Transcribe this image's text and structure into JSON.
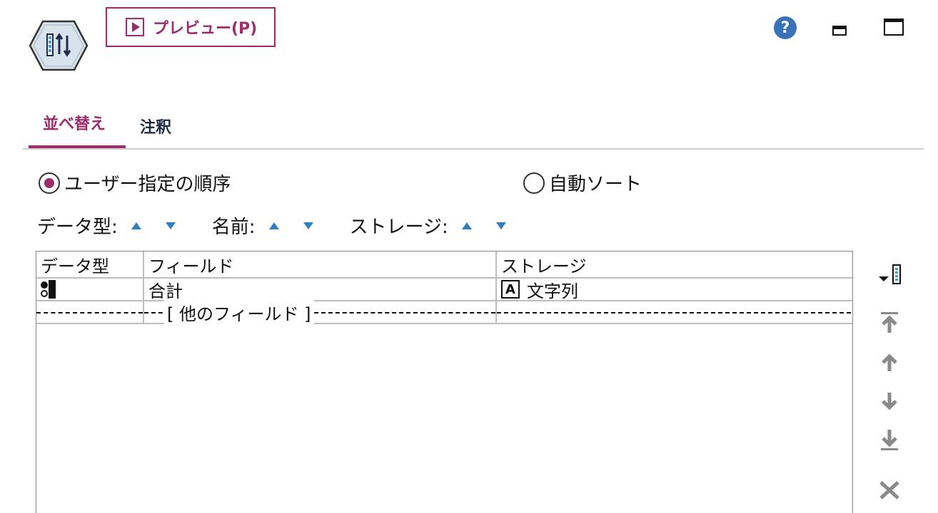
{
  "toolbar": {
    "preview_label": "プレビュー(P)",
    "help_glyph": "?"
  },
  "tabs": [
    {
      "label": "並べ替え",
      "active": true
    },
    {
      "label": "注釈",
      "active": false
    }
  ],
  "order_mode": {
    "custom_label": "ユーザー指定の順序",
    "auto_label": "自動ソート",
    "selected": "custom"
  },
  "sort_controls": {
    "type_label": "データ型:",
    "name_label": "名前:",
    "storage_label": "ストレージ:"
  },
  "table": {
    "columns": [
      "データ型",
      "フィールド",
      "ストレージ"
    ],
    "rows": [
      {
        "type_icon": "categorical-type-icon",
        "field": "合計",
        "storage_icon_glyph": "A",
        "storage": "文字列"
      }
    ],
    "other_fields_label": "[ 他のフィールド ]"
  },
  "colors": {
    "accent": "#a02b6a",
    "sort_arrow": "#2f7fc0",
    "help": "#3a72b9"
  }
}
